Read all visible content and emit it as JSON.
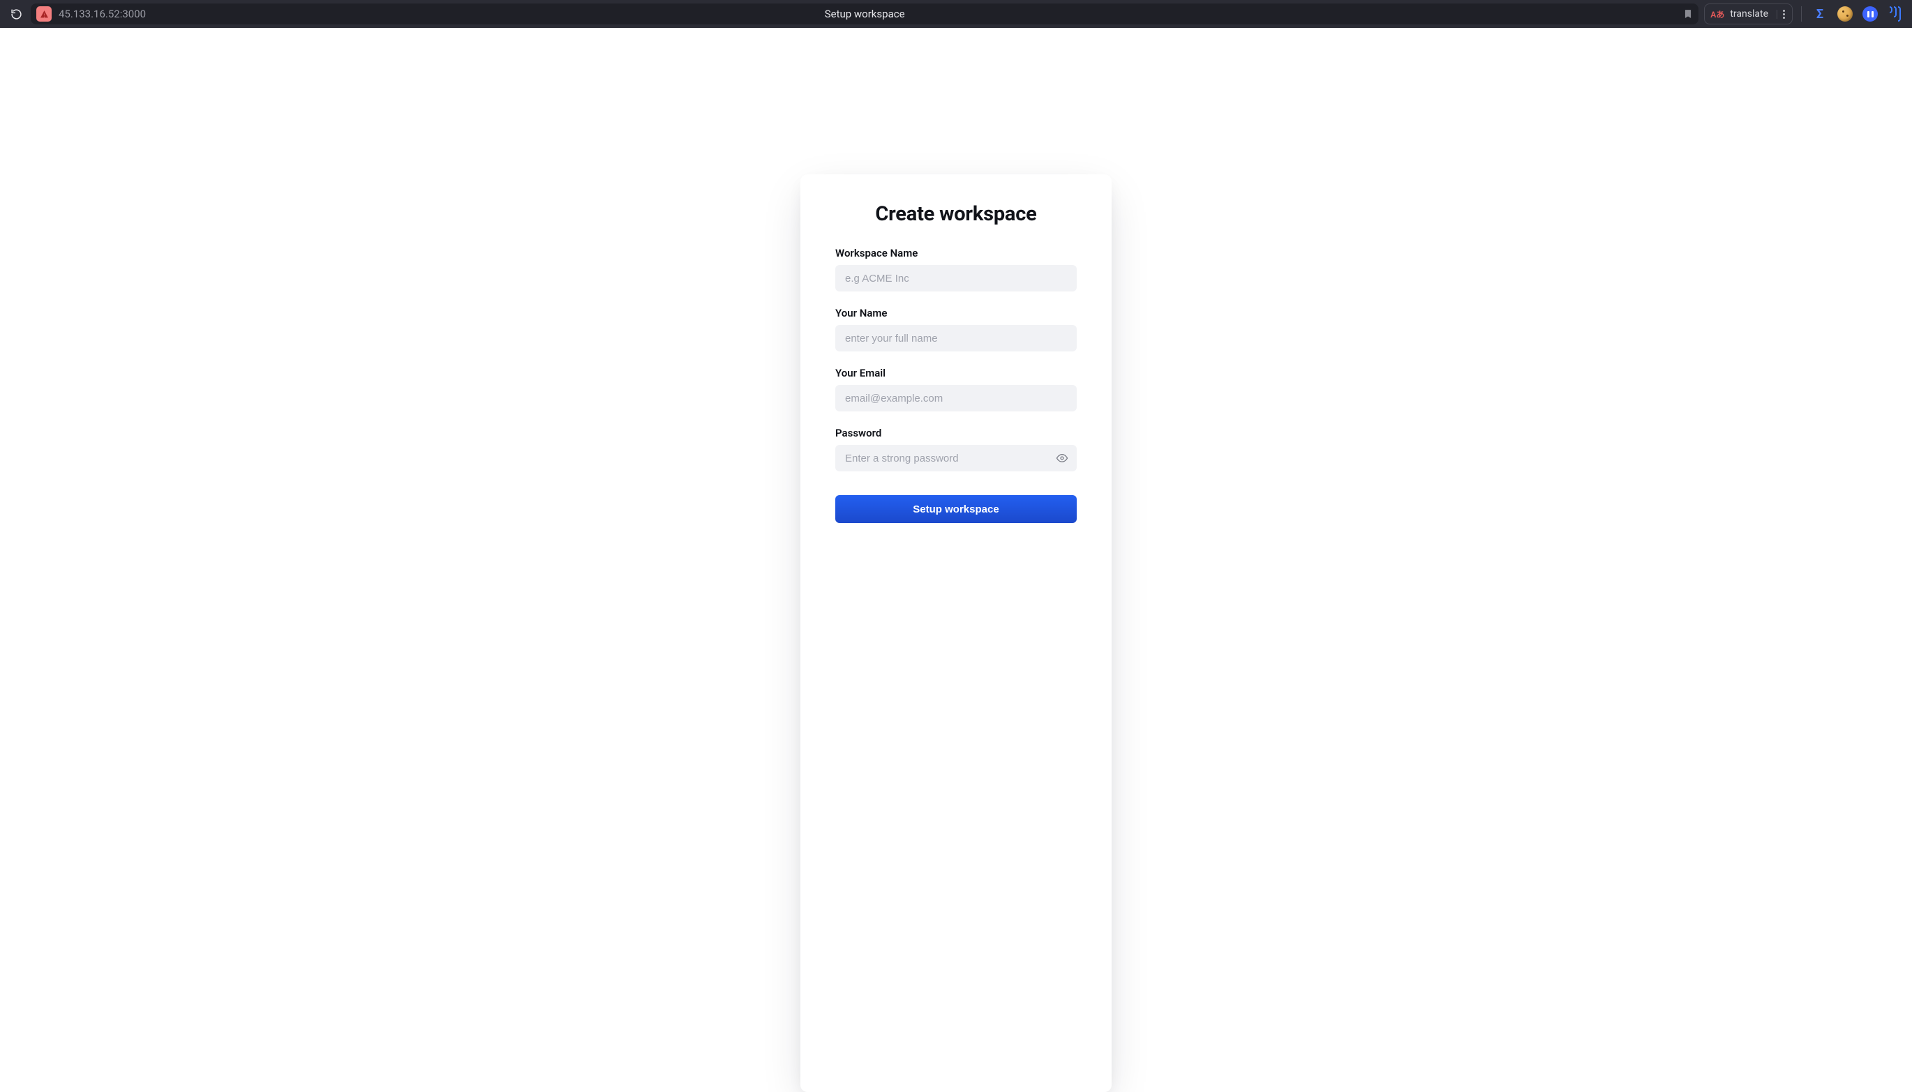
{
  "browser": {
    "url": "45.133.16.52:3000",
    "page_title": "Setup workspace",
    "translate_label": "translate"
  },
  "form": {
    "heading": "Create workspace",
    "fields": {
      "workspace_name": {
        "label": "Workspace Name",
        "placeholder": "e.g ACME Inc",
        "value": ""
      },
      "your_name": {
        "label": "Your Name",
        "placeholder": "enter your full name",
        "value": ""
      },
      "your_email": {
        "label": "Your Email",
        "placeholder": "email@example.com",
        "value": ""
      },
      "password": {
        "label": "Password",
        "placeholder": "Enter a strong password",
        "value": ""
      }
    },
    "submit_label": "Setup workspace"
  }
}
